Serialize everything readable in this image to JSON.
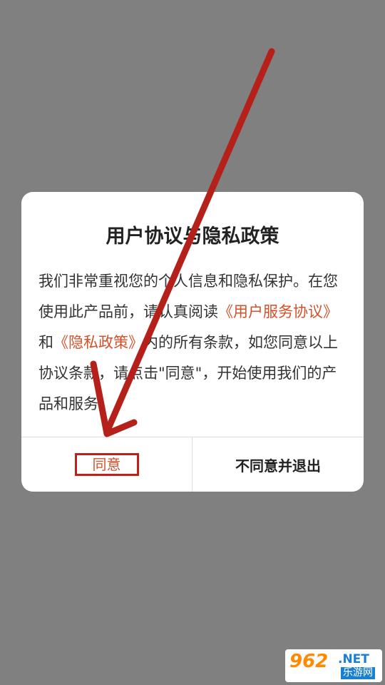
{
  "dialog": {
    "title": "用户协议与隐私政策",
    "body": {
      "part1": "我们非常重视您的个人信息和隐私保护。在您使用此产品前，请认真阅读",
      "link_user_agreement": "《用户服务协议》",
      "and": "和",
      "link_privacy_policy": "《隐私政策》",
      "part2": "内的所有条款，如您同意以上协议条款，请点击\"同意\"，开始使用我们的产品和服务!"
    },
    "agree_label": "同意",
    "decline_label": "不同意并退出"
  },
  "watermark": {
    "number": "962",
    "suffix": ".NET",
    "chinese": "乐游网"
  },
  "colors": {
    "accent": "#d4502a",
    "annotation": "#c0221a",
    "overlay": "#808080"
  }
}
